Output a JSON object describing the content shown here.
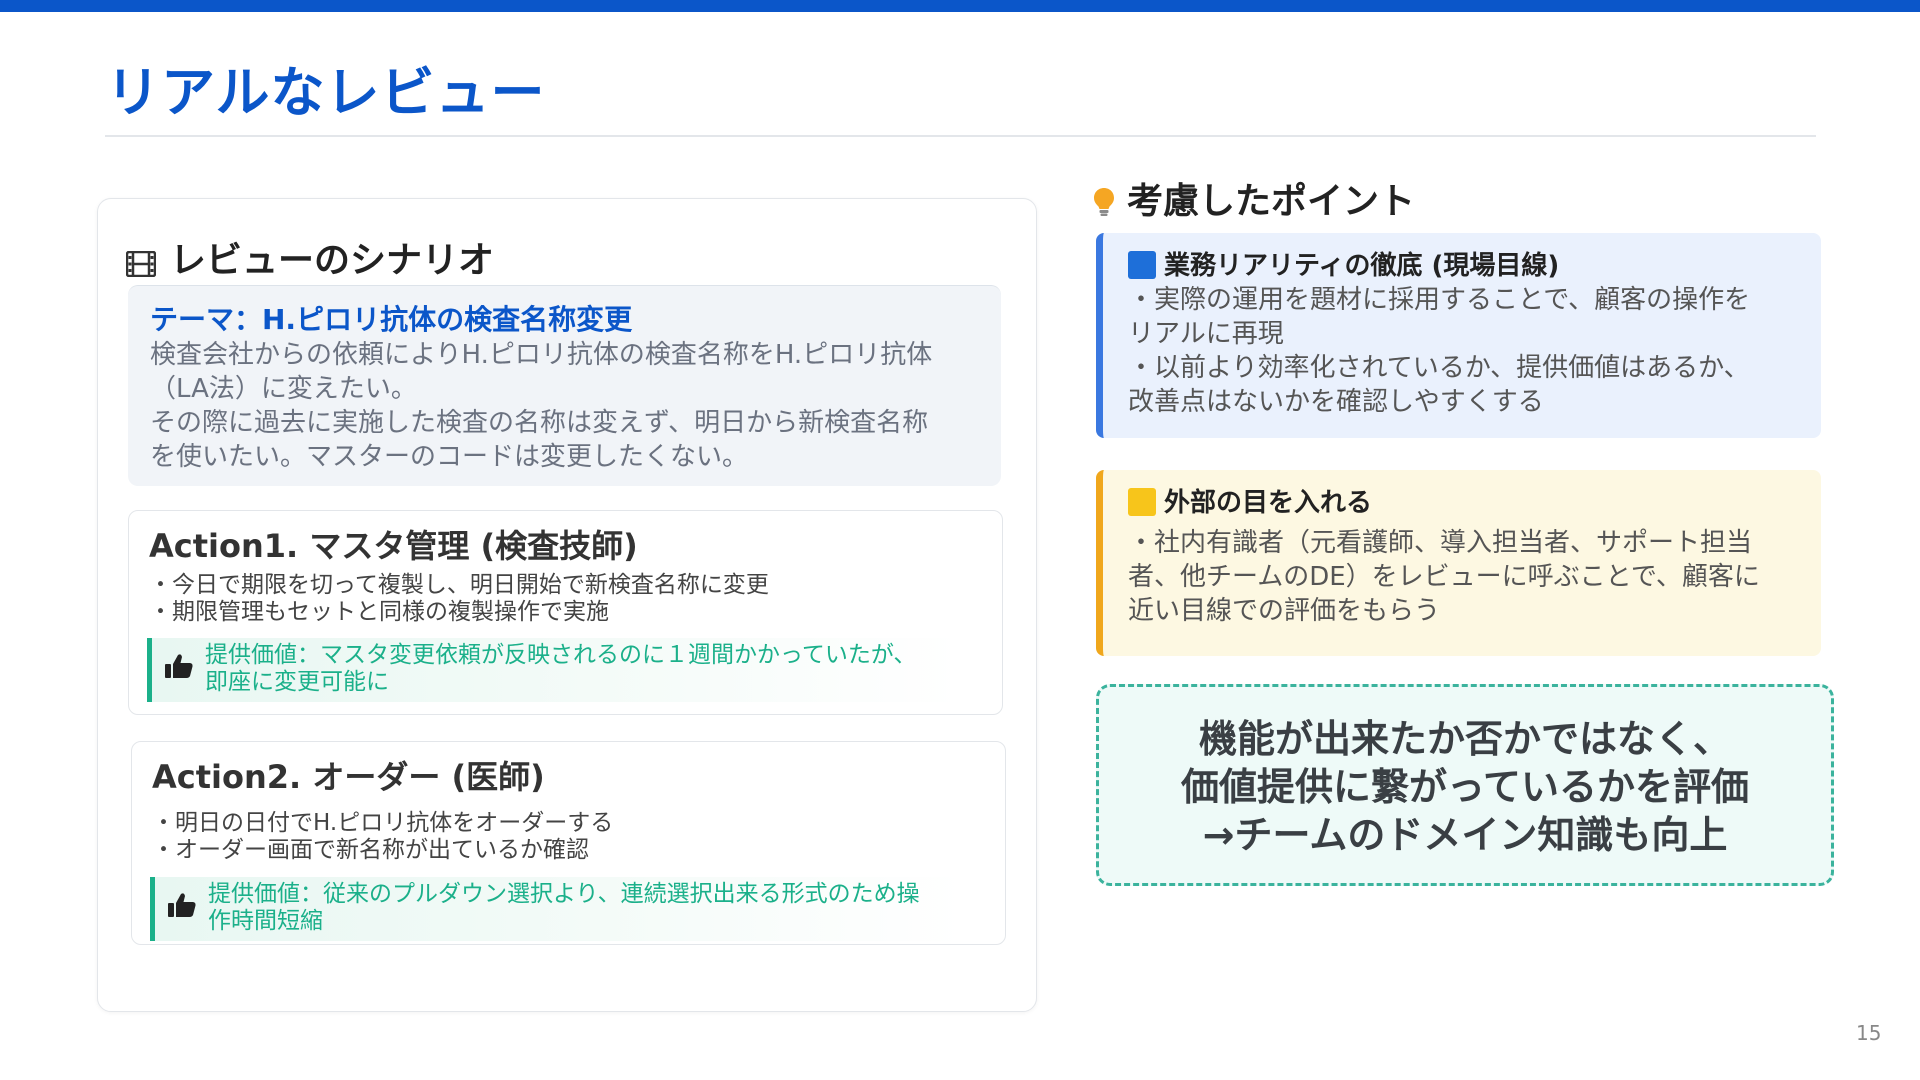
{
  "slide": {
    "title": "リアルなレビュー",
    "page_number": "15"
  },
  "scenario": {
    "heading": "レビューのシナリオ",
    "theme": {
      "title": "テーマ：H.ピロリ抗体の検査名称変更",
      "lines": [
        "検査会社からの依頼によりH.ピロリ抗体の検査名称をH.ピロリ抗体",
        "（LA法）に変えたい。",
        "その際に過去に実施した検査の名称は変えず、明日から新検査名称",
        "を使いたい。マスターのコードは変更したくない。"
      ]
    },
    "actions": [
      {
        "title": "Action1. マスタ管理 (検査技師)",
        "items": [
          "・今日で期限を切って複製し、明日開始で新検査名称に変更",
          "・期限管理もセットと同様の複製操作で実施"
        ],
        "value_lines": [
          "提供価値：マスタ変更依頼が反映されるのに１週間かかっていたが、",
          "即座に変更可能に"
        ]
      },
      {
        "title": "Action2. オーダー (医師)",
        "items": [
          "・明日の日付でH.ピロリ抗体をオーダーする",
          "・オーダー画面で新名称が出ているか確認"
        ],
        "value_lines": [
          "提供価値：従来のプルダウン選択より、連続選択出来る形式のため操",
          "作時間短縮"
        ]
      }
    ]
  },
  "points": {
    "heading": "考慮したポイント",
    "cards": [
      {
        "title": "業務リアリティの徹底 (現場目線)",
        "color": "#1e6fd9",
        "lines": [
          "・実際の運用を題材に採用することで、顧客の操作を",
          "リアルに再現",
          "・以前より効率化されているか、提供価値はあるか、",
          "改善点はないかを確認しやすくする"
        ]
      },
      {
        "title": "外部の目を入れる",
        "color": "#f7c51b",
        "lines": [
          "・社内有識者（元看護師、導入担当者、サポート担当",
          "者、他チームのDE）をレビューに呼ぶことで、顧客に",
          "近い目線での評価をもらう"
        ]
      }
    ],
    "conclusion_lines": [
      "機能が出来たか否かではなく、",
      "価値提供に繋がっているかを評価",
      "→チームのドメイン知識も向上"
    ]
  },
  "icons": [
    "film-icon",
    "lightbulb-icon",
    "thumbs-up-icon",
    "blue-square-icon",
    "yellow-square-icon"
  ]
}
